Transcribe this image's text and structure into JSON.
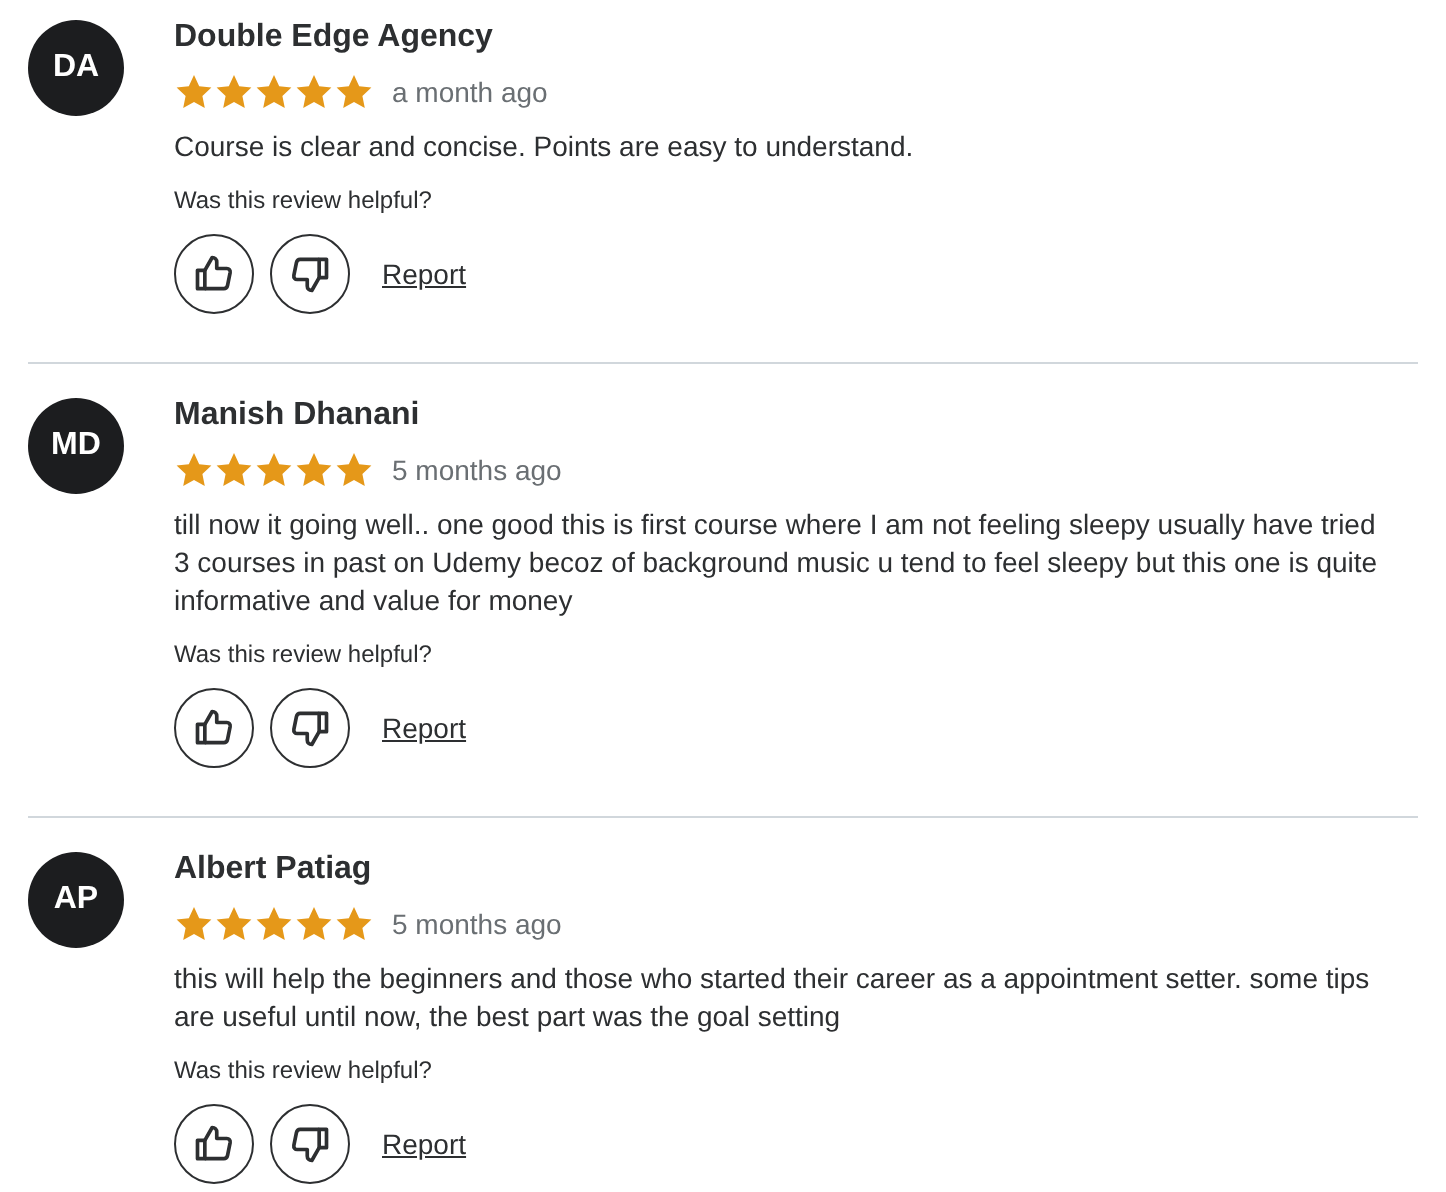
{
  "reviews": [
    {
      "initials": "DA",
      "name": "Double Edge Agency",
      "stars": 5,
      "time": "a month ago",
      "text": "Course is clear and concise. Points are easy to understand.",
      "helpful_prompt": "Was this review helpful?",
      "report": "Report"
    },
    {
      "initials": "MD",
      "name": "Manish Dhanani",
      "stars": 5,
      "time": "5 months ago",
      "text": "till now it going well.. one good this is first course where I am not feeling sleepy usually have tried 3 courses in past on Udemy becoz of background music u tend to feel sleepy but this one is quite informative and value for money",
      "helpful_prompt": "Was this review helpful?",
      "report": "Report"
    },
    {
      "initials": "AP",
      "name": "Albert Patiag",
      "stars": 5,
      "time": "5 months ago",
      "text": "this will help the beginners and those who started their career as a appointment setter. some tips are useful until now, the best part was the goal setting",
      "helpful_prompt": "Was this review helpful?",
      "report": "Report"
    }
  ]
}
